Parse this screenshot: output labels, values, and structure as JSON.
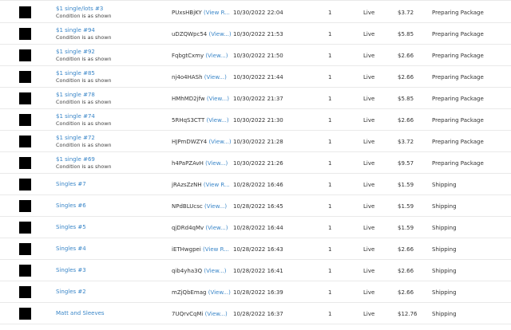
{
  "orders": [
    {
      "item": "$1 single/lots #3",
      "condition": "Condition is as shown",
      "order_id": "PUxsHBjKY",
      "view_text": "(View R...",
      "date": "10/30/2022 22:04",
      "qty": "1",
      "status": "Live",
      "price": "$3.72",
      "shipping": "Preparing Package"
    },
    {
      "item": "$1 single #94",
      "condition": "Condition is as shown",
      "order_id": "uDZQWpc54",
      "view_text": "(View...)",
      "date": "10/30/2022 21:53",
      "qty": "1",
      "status": "Live",
      "price": "$5.85",
      "shipping": "Preparing Package"
    },
    {
      "item": "$1 single #92",
      "condition": "Condition is as shown",
      "order_id": "FqbgtCxmy",
      "view_text": "(View...)",
      "date": "10/30/2022 21:50",
      "qty": "1",
      "status": "Live",
      "price": "$2.66",
      "shipping": "Preparing Package"
    },
    {
      "item": "$1 single #85",
      "condition": "Condition is as shown",
      "order_id": "nj4o4HASh",
      "view_text": "(View...)",
      "date": "10/30/2022 21:44",
      "qty": "1",
      "status": "Live",
      "price": "$2.66",
      "shipping": "Preparing Package"
    },
    {
      "item": "$1 single #78",
      "condition": "Condition is as shown",
      "order_id": "HMhMD2jfw",
      "view_text": "(View...)",
      "date": "10/30/2022 21:37",
      "qty": "1",
      "status": "Live",
      "price": "$5.85",
      "shipping": "Preparing Package"
    },
    {
      "item": "$1 single #74",
      "condition": "Condition is as shown",
      "order_id": "5RHqS3CTT",
      "view_text": "(View...)",
      "date": "10/30/2022 21:30",
      "qty": "1",
      "status": "Live",
      "price": "$2.66",
      "shipping": "Preparing Package"
    },
    {
      "item": "$1 single #72",
      "condition": "Condition is as shown",
      "order_id": "HJPmDWZY4",
      "view_text": "(View...)",
      "date": "10/30/2022 21:28",
      "qty": "1",
      "status": "Live",
      "price": "$3.72",
      "shipping": "Preparing Package"
    },
    {
      "item": "$1 single #69",
      "condition": "Condition is as shown",
      "order_id": "h4PaPZAvH",
      "view_text": "(View...)",
      "date": "10/30/2022 21:26",
      "qty": "1",
      "status": "Live",
      "price": "$9.57",
      "shipping": "Preparing Package"
    },
    {
      "item": "Singles #7",
      "condition": "",
      "order_id": "jRAzsZzNH",
      "view_text": "(View R...",
      "date": "10/28/2022 16:46",
      "qty": "1",
      "status": "Live",
      "price": "$1.59",
      "shipping": "Shipping"
    },
    {
      "item": "Singles #6",
      "condition": "",
      "order_id": "NPdBLUcsc",
      "view_text": "(View...)",
      "date": "10/28/2022 16:45",
      "qty": "1",
      "status": "Live",
      "price": "$1.59",
      "shipping": "Shipping"
    },
    {
      "item": "Singles #5",
      "condition": "",
      "order_id": "qjDRd4qMv",
      "view_text": "(View...)",
      "date": "10/28/2022 16:44",
      "qty": "1",
      "status": "Live",
      "price": "$1.59",
      "shipping": "Shipping"
    },
    {
      "item": "Singles #4",
      "condition": "",
      "order_id": "iETHwgpei",
      "view_text": "(View R...",
      "date": "10/28/2022 16:43",
      "qty": "1",
      "status": "Live",
      "price": "$2.66",
      "shipping": "Shipping"
    },
    {
      "item": "Singles #3",
      "condition": "",
      "order_id": "qib4yha3Q",
      "view_text": "(View...)",
      "date": "10/28/2022 16:41",
      "qty": "1",
      "status": "Live",
      "price": "$2.66",
      "shipping": "Shipping"
    },
    {
      "item": "Singles #2",
      "condition": "",
      "order_id": "mZjQbEmag",
      "view_text": "(View...)",
      "date": "10/28/2022 16:39",
      "qty": "1",
      "status": "Live",
      "price": "$2.66",
      "shipping": "Shipping"
    },
    {
      "item": "Matt and Sleeves",
      "condition": "",
      "order_id": "7UQrvCqMi",
      "view_text": "(View...)",
      "date": "10/28/2022 16:37",
      "qty": "1",
      "status": "Live",
      "price": "$12.76",
      "shipping": "Shipping"
    }
  ]
}
